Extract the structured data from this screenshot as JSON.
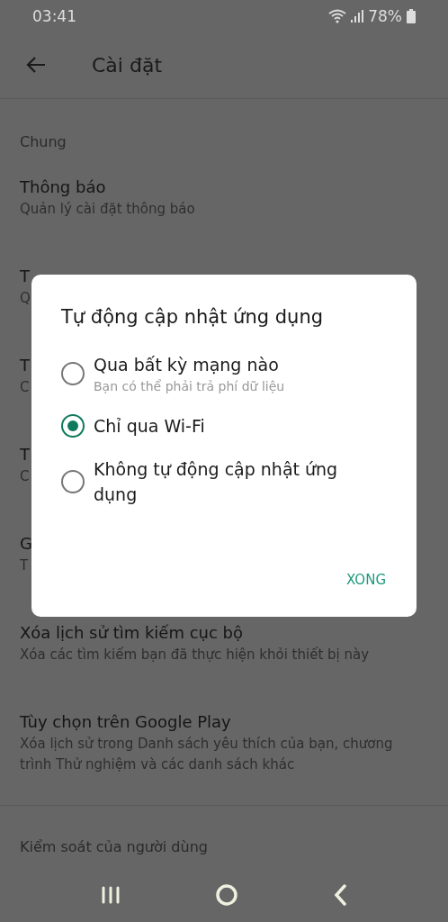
{
  "status_bar": {
    "time": "03:41",
    "battery": "78%"
  },
  "header": {
    "title": "Cài đặt"
  },
  "section": "Chung",
  "items": [
    {
      "title": "Thông báo",
      "subtitle": "Quản lý cài đặt thông báo"
    },
    {
      "title": "T",
      "subtitle": "Q"
    },
    {
      "title": "T",
      "subtitle": "C"
    },
    {
      "title": "T",
      "subtitle": "C"
    },
    {
      "title": "G",
      "subtitle": "T"
    },
    {
      "title": "Xóa lịch sử tìm kiếm cục bộ",
      "subtitle": "Xóa các tìm kiếm bạn đã thực hiện khỏi thiết bị này"
    },
    {
      "title": "Tùy chọn trên Google Play",
      "subtitle": "Xóa lịch sử trong Danh sách yêu thích của bạn, chương trình Thử nghiệm và các danh sách khác"
    }
  ],
  "section_2": "Kiểm soát của người dùng",
  "dialog": {
    "title": "Tự động cập nhật ứng dụng",
    "options": [
      {
        "label": "Qua bất kỳ mạng nào",
        "description": "Bạn có thể phải trả phí dữ liệu",
        "selected": false
      },
      {
        "label": "Chỉ qua Wi-Fi",
        "selected": true
      },
      {
        "label": "Không tự động cập nhật ứng dụng",
        "selected": false
      }
    ],
    "button": "XONG"
  }
}
